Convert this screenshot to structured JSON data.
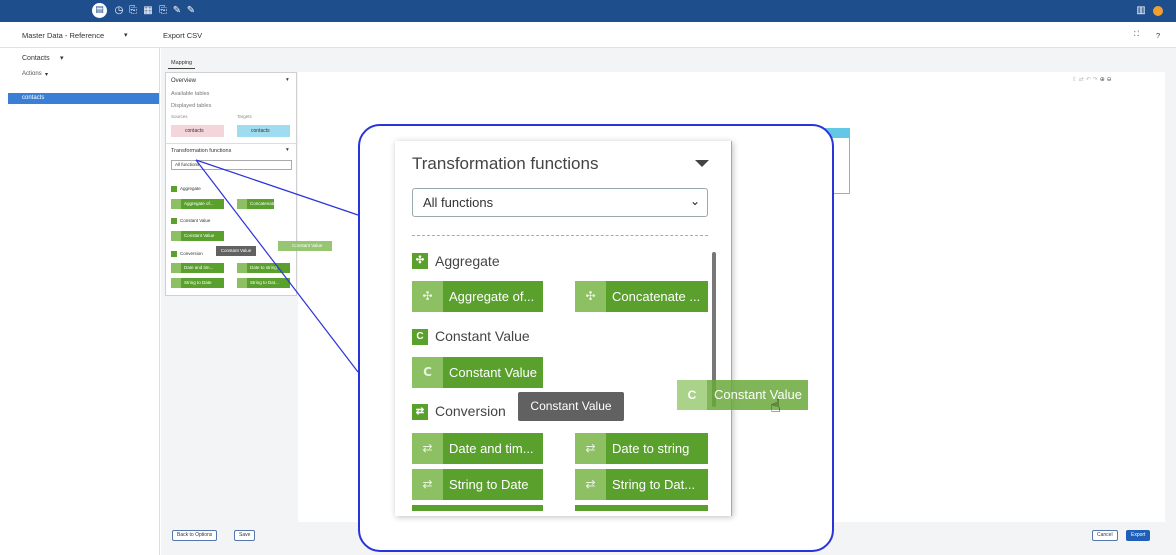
{
  "header": {
    "app_title": "Master Data - Reference",
    "page_title": "Export CSV",
    "help": "?"
  },
  "sidebar": {
    "title": "Contacts",
    "actions": "Actions",
    "items": [
      {
        "label": "contacts"
      }
    ]
  },
  "tabs": [
    {
      "label": "Mapping"
    }
  ],
  "overview": {
    "title": "Overview",
    "available_tables": "Available tables",
    "displayed_tables": "Displayed tables",
    "sources_label": "Sources",
    "targets_label": "Targets",
    "source_table": "contacts",
    "target_table": "contacts"
  },
  "transformation": {
    "title": "Transformation functions",
    "filter_value": "All functions",
    "filter_value_short": "All functions",
    "categories": [
      {
        "label": "Aggregate",
        "icon": "aggregate-icon"
      },
      {
        "label": "Constant Value",
        "icon": "C"
      },
      {
        "label": "Conversion",
        "icon": "conversion-icon"
      }
    ],
    "functions": {
      "aggregate_of": "Aggregate of...",
      "concatenate": "Concatenate ...",
      "constant_value": "Constant Value",
      "date_and_time": "Date and tim...",
      "date_to_string": "Date to string",
      "string_to_date": "String to Date",
      "string_to_date_2": "String to Dat..."
    },
    "small_functions": {
      "aggregate_of": "Aggregate of...",
      "concatenate": "Concatenate",
      "constant_value": "Constant Value",
      "date_and_time": "Date and tim...",
      "date_to_string": "Date to string",
      "string_to_date": "String to Date",
      "string_to_date_2": "String to Dat..."
    },
    "tooltip": "Constant Value",
    "dragged_item": "Constant Value",
    "dragged_item_icon": "C"
  },
  "footer": {
    "back_to_options": "Back to Options",
    "save": "Save",
    "cancel": "Cancel",
    "export": "Export"
  },
  "colors": {
    "topbar": "#1f4e8c",
    "accent": "#3a7fd5",
    "function_green": "#5aa02c",
    "callout_border": "#2b34d8"
  }
}
